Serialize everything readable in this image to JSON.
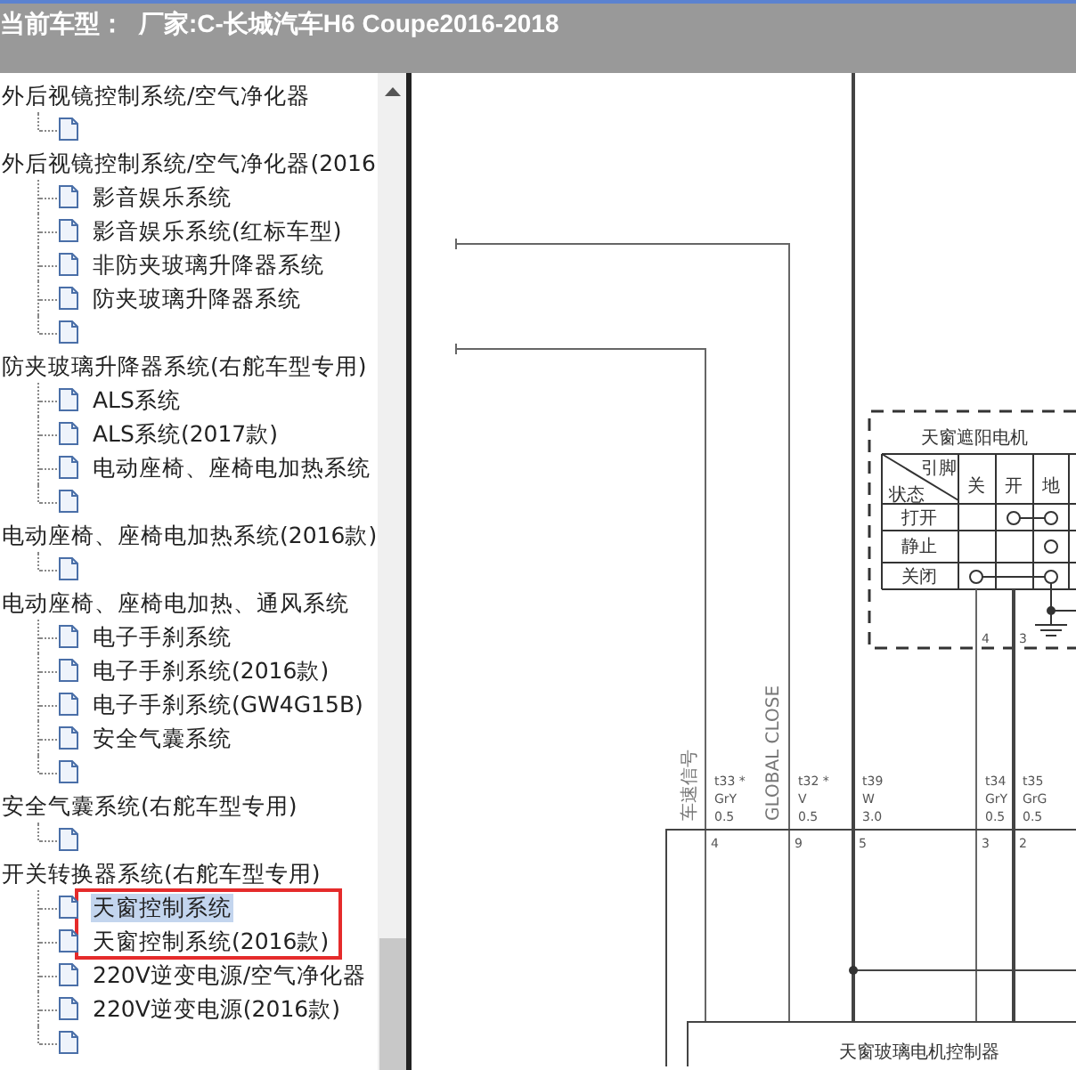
{
  "title_bar": {
    "model_label": "当前车型：",
    "model_value": "厂家:C-长城汽车H6 Coupe2016-2018"
  },
  "tree": {
    "items": [
      {
        "label": "外后视镜控制系统/空气净化器",
        "selected": false,
        "children": [
          {
            "framed": false
          }
        ]
      },
      {
        "label": "外后视镜控制系统/空气净化器(2016",
        "selected": false,
        "children": [
          {
            "label": "影音娱乐系统",
            "selected": false,
            "framed": false
          },
          {
            "label": "影音娱乐系统(红标车型)",
            "selected": false,
            "framed": false
          },
          {
            "label": "非防夹玻璃升降器系统",
            "selected": false,
            "framed": false
          },
          {
            "label": "防夹玻璃升降器系统",
            "selected": false,
            "framed": false
          },
          {
            "framed": false
          }
        ]
      },
      {
        "label": "防夹玻璃升降器系统(右舵车型专用)",
        "selected": false,
        "children": [
          {
            "label": "ALS系统",
            "selected": false,
            "framed": false
          },
          {
            "label": "ALS系统(2017款)",
            "selected": false,
            "framed": false
          },
          {
            "label": "电动座椅、座椅电加热系统",
            "selected": false,
            "framed": false
          },
          {
            "framed": false
          }
        ]
      },
      {
        "label": "电动座椅、座椅电加热系统(2016款)",
        "selected": false,
        "children": [
          {
            "framed": false
          }
        ]
      },
      {
        "label": "电动座椅、座椅电加热、通风系统",
        "selected": false,
        "children": [
          {
            "label": "电子手刹系统",
            "selected": false,
            "framed": false
          },
          {
            "label": "电子手刹系统(2016款)",
            "selected": false,
            "framed": false
          },
          {
            "label": "电子手刹系统(GW4G15B)",
            "selected": false,
            "framed": false
          },
          {
            "label": "安全气囊系统",
            "selected": false,
            "framed": false
          },
          {
            "framed": false
          }
        ]
      },
      {
        "label": "安全气囊系统(右舵车型专用)",
        "selected": false,
        "children": [
          {
            "framed": false
          }
        ]
      },
      {
        "label": "开关转换器系统(右舵车型专用)",
        "selected": false,
        "children": [
          {
            "label": "天窗控制系统",
            "selected": true,
            "framed": true
          },
          {
            "label": "天窗控制系统(2016款)",
            "selected": false,
            "framed": true
          },
          {
            "label": "220V逆变电源/空气净化器",
            "selected": false,
            "framed": false
          },
          {
            "label": "220V逆变电源(2016款)",
            "selected": false,
            "framed": false
          },
          {
            "framed": false
          }
        ]
      }
    ]
  },
  "diagram": {
    "motor_label": "天窗遮阳电机",
    "table": {
      "corner_top": "引脚",
      "corner_bottom": "状态",
      "columns": [
        "关",
        "开",
        "地"
      ],
      "rows": [
        "打开",
        "静止",
        "关闭"
      ]
    },
    "motor_pins": [
      "4",
      "3"
    ],
    "wires": [
      {
        "signal": "车速信号",
        "code": "t33 *",
        "wire_color": "GrY",
        "size": "0.5",
        "pin": "4"
      },
      {
        "signal": "GLOBAL CLOSE",
        "code": "t32 *",
        "wire_color": "V",
        "size": "0.5",
        "pin": "9"
      },
      {
        "code": "t39",
        "wire_color": "W",
        "size": "3.0",
        "pin": "5"
      },
      {
        "code": "t34",
        "wire_color": "GrY",
        "size": "0.5",
        "pin": "3"
      },
      {
        "code": "t35",
        "wire_color": "GrG",
        "size": "0.5",
        "pin": "2"
      }
    ],
    "controller_label": "天窗玻璃电机控制器"
  }
}
